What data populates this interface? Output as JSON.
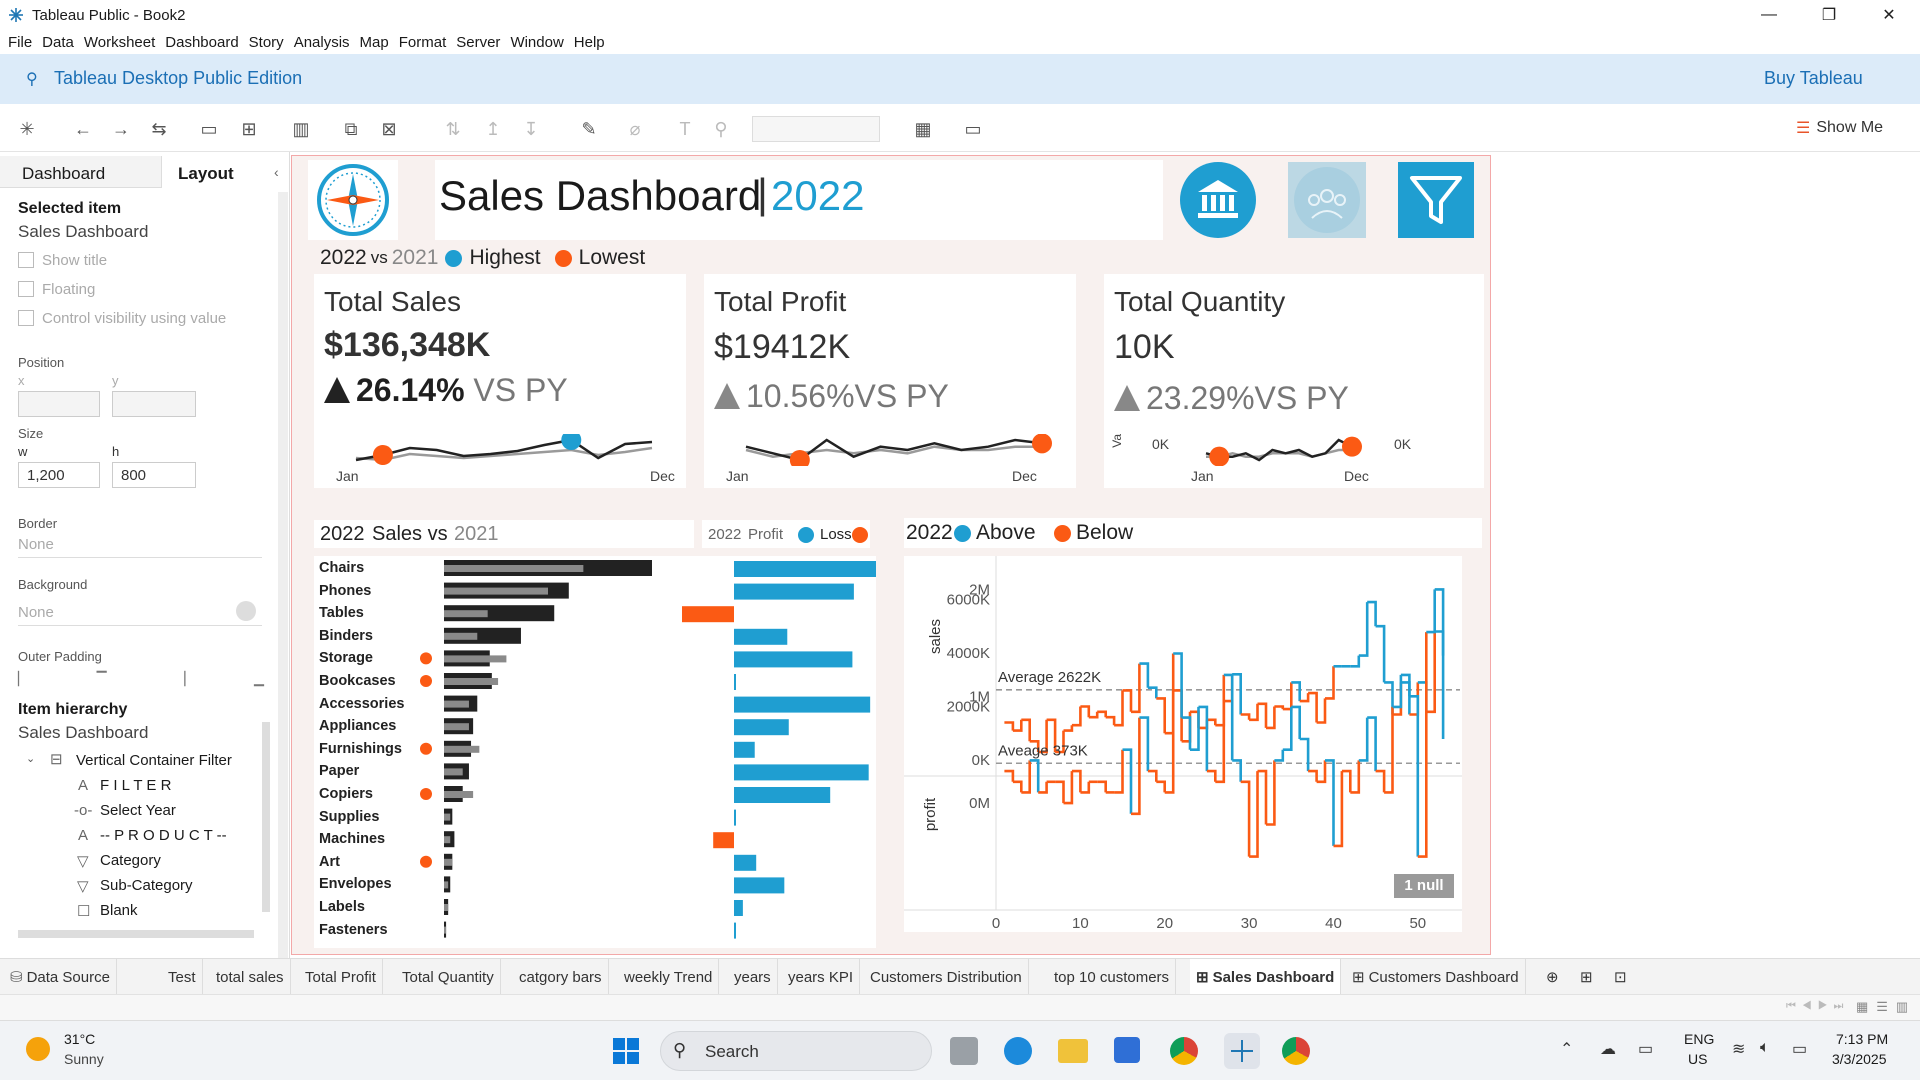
{
  "window": {
    "title": "Tableau Public - Book2",
    "minimize": "—",
    "restore": "❐",
    "close": "✕"
  },
  "menu": [
    "File",
    "Data",
    "Worksheet",
    "Dashboard",
    "Story",
    "Analysis",
    "Map",
    "Format",
    "Server",
    "Window",
    "Help"
  ],
  "banner": {
    "edition": "Tableau Desktop Public Edition",
    "buy": "Buy Tableau"
  },
  "toolbar": {
    "show_me": "Show Me"
  },
  "left_pane": {
    "tabs": [
      "Dashboard",
      "Layout"
    ],
    "selected_item_label": "Selected item",
    "selected_item_value": "Sales Dashboard",
    "checkboxes": [
      "Show title",
      "Floating",
      "Control visibility using value"
    ],
    "position_label": "Position",
    "x_label": "x",
    "y_label": "y",
    "size_label": "Size",
    "w_label": "w",
    "h_label": "h",
    "w_value": "1,200",
    "h_value": "800",
    "border_label": "Border",
    "border_value": "None",
    "background_label": "Background",
    "background_value": "None",
    "outer_padding_label": "Outer Padding",
    "hierarchy_label": "Item hierarchy",
    "hierarchy_root": "Sales Dashboard",
    "hierarchy_items": [
      {
        "icon": "container",
        "text": "Vertical Container Filter"
      },
      {
        "icon": "text",
        "text": "F I L T E R"
      },
      {
        "icon": "parameter",
        "text": "Select Year"
      },
      {
        "icon": "text",
        "text": "-- P R O D U C T --"
      },
      {
        "icon": "filter",
        "text": "Category"
      },
      {
        "icon": "filter",
        "text": "Sub-Category"
      },
      {
        "icon": "blank",
        "text": "Blank"
      }
    ]
  },
  "dashboard": {
    "title": "Sales Dashboard",
    "title_sep": "|",
    "title_year": "2022",
    "legend": {
      "year": "2022",
      "vs": "vs",
      "prev_year": "2021",
      "highest": "Highest",
      "lowest": "Lowest"
    },
    "colors": {
      "blue": "#1f9ed1",
      "orange": "#fb5a14",
      "dark": "#222222",
      "gray": "#8a8a8a"
    },
    "kpis": [
      {
        "title": "Total Sales",
        "value": "$136,348K",
        "pct": "26.14%",
        "vs": " VS PY",
        "start": "Jan",
        "end": "Dec"
      },
      {
        "title": "Total Profit",
        "value": "$19412K",
        "pct": "10.56%",
        "vs": "VS PY",
        "start": "Jan",
        "end": "Dec"
      },
      {
        "title": "Total Quantity",
        "value": "10K",
        "pct": "23.29%",
        "vs": "VS PY",
        "start": "Jan",
        "end": "Dec",
        "axis_left": "0K",
        "axis_right": "0K",
        "axis_name": "Va"
      }
    ],
    "bars_header": {
      "year": "2022",
      "label": "Sales vs",
      "prev_year": "2021"
    },
    "profit_header": {
      "year": "2022",
      "label": "Profit",
      "loss": "Loss"
    },
    "trend_header": {
      "year": "2022",
      "above": "Above",
      "below": "Below"
    },
    "trend_labels": {
      "sales_axis": "sales",
      "profit_axis": "profit",
      "sales_ticks": [
        "6000K",
        "4000K",
        "2000K",
        "0K"
      ],
      "profit_ticks": [
        "2M",
        "1M",
        "0M"
      ],
      "x_ticks": [
        "0",
        "10",
        "20",
        "30",
        "40",
        "50"
      ],
      "sales_avg": "Average 2622K",
      "profit_avg": "Aveage 373K",
      "null_badge": "1 null"
    }
  },
  "chart_data": [
    {
      "type": "bar",
      "title": "2022 Sales vs 2021",
      "categories": [
        "Chairs",
        "Phones",
        "Tables",
        "Binders",
        "Storage",
        "Bookcases",
        "Accessories",
        "Appliances",
        "Furnishings",
        "Paper",
        "Copiers",
        "Supplies",
        "Machines",
        "Art",
        "Envelopes",
        "Labels",
        "Fasteners"
      ],
      "lowest_flag": [
        false,
        false,
        false,
        false,
        true,
        true,
        false,
        false,
        true,
        false,
        true,
        false,
        false,
        true,
        false,
        false,
        false
      ],
      "series": [
        {
          "name": "2022",
          "values": [
            100,
            60,
            53,
            37,
            22,
            23,
            16,
            14,
            13,
            12,
            9,
            4,
            5,
            4,
            3,
            2,
            1
          ]
        },
        {
          "name": "2021",
          "values": [
            67,
            50,
            21,
            16,
            30,
            26,
            12,
            12,
            17,
            9,
            14,
            3,
            3,
            4,
            2,
            2,
            1
          ]
        }
      ]
    },
    {
      "type": "bar",
      "title": "2022 Profit",
      "categories": [
        "Chairs",
        "Phones",
        "Tables",
        "Binders",
        "Storage",
        "Bookcases",
        "Accessories",
        "Appliances",
        "Furnishings",
        "Paper",
        "Copiers",
        "Supplies",
        "Machines",
        "Art",
        "Envelopes",
        "Labels",
        "Fasteners"
      ],
      "values": [
        100,
        81,
        -35,
        36,
        80,
        1,
        92,
        37,
        14,
        91,
        65,
        1,
        -14,
        15,
        34,
        6,
        1
      ]
    },
    {
      "type": "line",
      "title": "Total Sales monthly trend",
      "x": [
        "Jan",
        "Feb",
        "Mar",
        "Apr",
        "May",
        "Jun",
        "Jul",
        "Aug",
        "Sep",
        "Oct",
        "Nov",
        "Dec"
      ],
      "series": [
        {
          "name": "2022",
          "values": [
            40,
            45,
            52,
            50,
            44,
            46,
            49,
            55,
            60,
            42,
            56,
            58
          ]
        },
        {
          "name": "2021",
          "values": [
            42,
            40,
            46,
            44,
            42,
            44,
            46,
            48,
            50,
            45,
            48,
            52
          ]
        }
      ],
      "highest_index": 8,
      "lowest_index": 1
    },
    {
      "type": "line",
      "title": "Total Profit monthly trend",
      "x": [
        "Jan",
        "Feb",
        "Mar",
        "Apr",
        "May",
        "Jun",
        "Jul",
        "Aug",
        "Sep",
        "Oct",
        "Nov",
        "Dec"
      ],
      "series": [
        {
          "name": "2022",
          "values": [
            50,
            48,
            46,
            52,
            47,
            50,
            49,
            51,
            49,
            50,
            52,
            51
          ]
        },
        {
          "name": "2021",
          "values": [
            49,
            47,
            48,
            49,
            48,
            49,
            48,
            50,
            49,
            49,
            50,
            50
          ]
        }
      ],
      "highest_index": 11,
      "lowest_index": 2
    },
    {
      "type": "line",
      "title": "Total Quantity monthly trend",
      "x": [
        "Jan",
        "Feb",
        "Mar",
        "Apr",
        "May",
        "Jun",
        "Jul",
        "Aug",
        "Sep",
        "Oct",
        "Nov",
        "Dec"
      ],
      "series": [
        {
          "name": "2022",
          "values": [
            48,
            47,
            47,
            48,
            46,
            49,
            48,
            49,
            47,
            48,
            52,
            50
          ]
        },
        {
          "name": "2021",
          "values": [
            47,
            47,
            48,
            47,
            47,
            48,
            48,
            48,
            47,
            48,
            49,
            49
          ]
        }
      ],
      "highest_index": 11,
      "lowest_index": 1
    },
    {
      "type": "line",
      "title": "Weekly sales",
      "xlim": [
        0,
        55
      ],
      "ylim": [
        0,
        6500
      ],
      "average": 2622,
      "x": [
        1,
        2,
        3,
        4,
        5,
        6,
        7,
        8,
        9,
        10,
        11,
        12,
        13,
        14,
        15,
        16,
        17,
        18,
        19,
        20,
        21,
        22,
        23,
        24,
        25,
        26,
        27,
        28,
        29,
        30,
        31,
        32,
        33,
        34,
        35,
        36,
        37,
        38,
        39,
        40,
        41,
        42,
        43,
        44,
        45,
        46,
        47,
        48,
        49,
        50,
        51,
        52,
        53
      ],
      "values": [
        1400,
        1100,
        1500,
        700,
        300,
        1500,
        300,
        1100,
        1300,
        2000,
        1600,
        1800,
        1600,
        1300,
        2600,
        1800,
        3600,
        2700,
        2300,
        1000,
        2600,
        700,
        1800,
        1200,
        1500,
        1300,
        2200,
        3200,
        1700,
        1500,
        2100,
        1200,
        2000,
        1900,
        2900,
        2200,
        2500,
        1400,
        2300,
        3500,
        3500,
        3500,
        3900,
        5900,
        5000,
        2900,
        1700,
        2900,
        1700,
        2900,
        1800,
        4800,
        3900,
        2600
      ]
    },
    {
      "type": "line",
      "title": "Weekly profit",
      "xlim": [
        0,
        55
      ],
      "ylim": [
        -1000,
        2200
      ],
      "average": 373,
      "x": [
        1,
        2,
        3,
        4,
        5,
        6,
        7,
        8,
        9,
        10,
        11,
        12,
        13,
        14,
        15,
        16,
        17,
        18,
        19,
        20,
        21,
        22,
        23,
        24,
        25,
        26,
        27,
        28,
        29,
        30,
        31,
        32,
        33,
        34,
        35,
        36,
        37,
        38,
        39,
        40,
        41,
        42,
        43,
        44,
        45,
        46,
        47,
        48,
        49,
        50,
        51,
        52,
        53
      ],
      "values": [
        300,
        200,
        100,
        400,
        100,
        200,
        200,
        0,
        300,
        100,
        200,
        200,
        100,
        100,
        500,
        -100,
        800,
        300,
        200,
        100,
        1400,
        800,
        500,
        900,
        300,
        200,
        1200,
        400,
        200,
        -500,
        300,
        -200,
        400,
        500,
        900,
        600,
        300,
        200,
        400,
        -400,
        300,
        100,
        400,
        800,
        300,
        100,
        900,
        1200,
        1000,
        -500,
        1600,
        2000,
        600
      ]
    }
  ],
  "sheet_tabs": [
    "Data Source",
    "Test",
    "total sales",
    "Total Profit",
    "Total Quantity",
    "catgory bars",
    "weekly Trend",
    "years",
    "years KPI",
    "Customers Distribution",
    "top 10 customers",
    "Sales Dashboard",
    "Customers Dashboard"
  ],
  "taskbar": {
    "temp": "31°C",
    "weather": "Sunny",
    "search": "Search",
    "lang1": "ENG",
    "lang2": "US",
    "time": "7:13 PM",
    "date": "3/3/2025"
  }
}
